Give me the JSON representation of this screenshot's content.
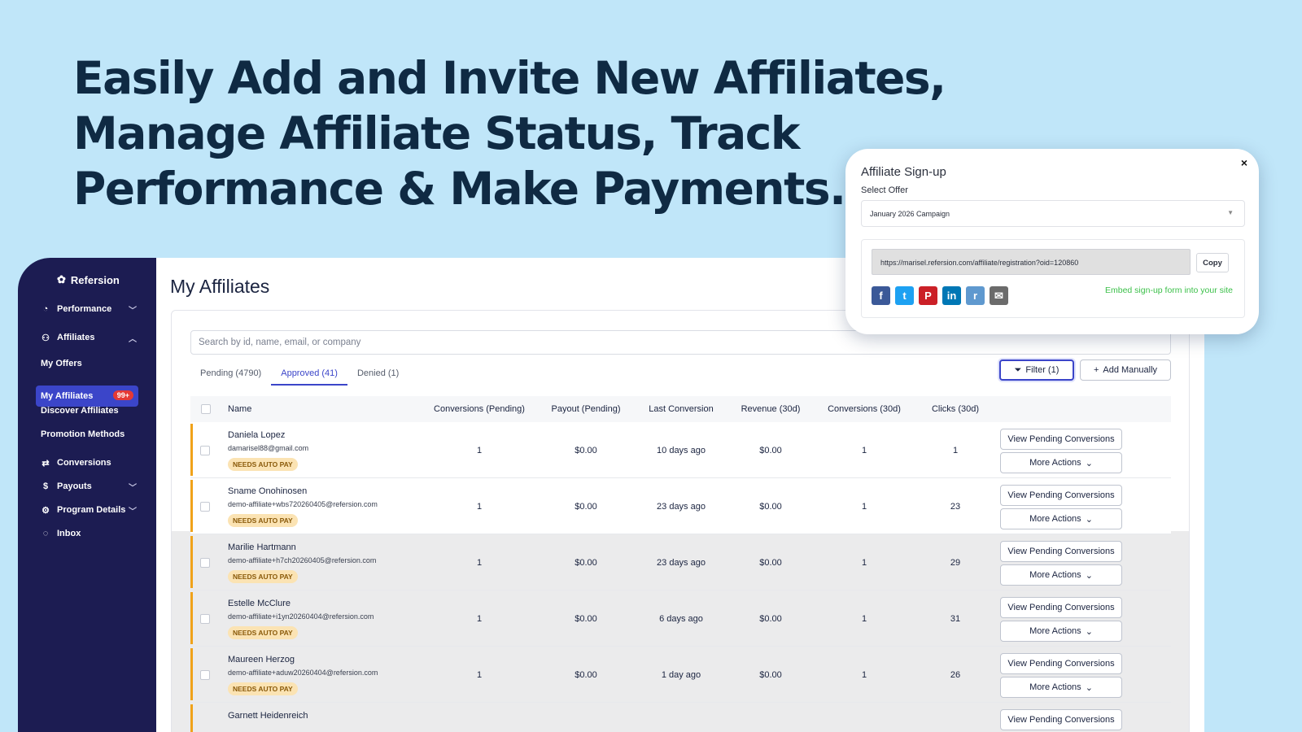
{
  "headline": [
    "Easily Add and Invite New Affiliates,",
    "Manage Affiliate Status, Track",
    "Performance & Make Payments."
  ],
  "sidebar": {
    "brand": "Refersion",
    "items": {
      "performance": "Performance",
      "affiliates": "Affiliates",
      "my_offers": "My Offers",
      "my_affiliates": "My Affiliates",
      "my_affiliates_badge": "99+",
      "discover": "Discover Affiliates",
      "promotion": "Promotion Methods",
      "conversions": "Conversions",
      "payouts": "Payouts",
      "program": "Program Details",
      "inbox": "Inbox"
    }
  },
  "main": {
    "title": "My Affiliates",
    "search_placeholder": "Search by id, name, email, or company",
    "tabs": [
      "Pending (4790)",
      "Approved (41)",
      "Denied (1)"
    ],
    "active_tab": 1,
    "filter_label": "Filter (1)",
    "add_label": "Add Manually",
    "columns": [
      "Name",
      "Conversions (Pending)",
      "Payout (Pending)",
      "Last Conversion",
      "Revenue (30d)",
      "Conversions (30d)",
      "Clicks (30d)"
    ],
    "status_label": "NEEDS AUTO PAY",
    "view_label": "View Pending Conversions",
    "more_label": "More Actions",
    "rows": [
      {
        "name": "Daniela Lopez",
        "email": "damarisel88@gmail.com",
        "conv_pending": "1",
        "payout_pending": "$0.00",
        "last_conv": "10 days ago",
        "revenue": "$0.00",
        "conv30": "1",
        "clicks": "1"
      },
      {
        "name": "Sname Onohinosen",
        "email": "demo-affiliate+wbs720260405@refersion.com",
        "conv_pending": "1",
        "payout_pending": "$0.00",
        "last_conv": "23 days ago",
        "revenue": "$0.00",
        "conv30": "1",
        "clicks": "23"
      },
      {
        "name": "Marilie Hartmann",
        "email": "demo-affiliate+h7ch20260405@refersion.com",
        "conv_pending": "1",
        "payout_pending": "$0.00",
        "last_conv": "23 days ago",
        "revenue": "$0.00",
        "conv30": "1",
        "clicks": "29"
      },
      {
        "name": "Estelle McClure",
        "email": "demo-affiliate+i1yn20260404@refersion.com",
        "conv_pending": "1",
        "payout_pending": "$0.00",
        "last_conv": "6 days ago",
        "revenue": "$0.00",
        "conv30": "1",
        "clicks": "31"
      },
      {
        "name": "Maureen Herzog",
        "email": "demo-affiliate+aduw20260404@refersion.com",
        "conv_pending": "1",
        "payout_pending": "$0.00",
        "last_conv": "1 day ago",
        "revenue": "$0.00",
        "conv30": "1",
        "clicks": "26"
      },
      {
        "name": "Garnett Heidenreich"
      }
    ]
  },
  "modal": {
    "title": "Affiliate Sign-up",
    "close": "×",
    "select_label": "Select Offer",
    "selected_offer": "January 2026 Campaign",
    "url": "https://marisel.refersion.com/affiliate/registration?oid=120860",
    "copy_label": "Copy",
    "embed_label": "Embed sign-up form into your site",
    "socials": [
      {
        "name": "facebook-icon",
        "glyph": "f",
        "color": "#3b5998"
      },
      {
        "name": "twitter-icon",
        "glyph": "t",
        "color": "#1da1f2"
      },
      {
        "name": "pinterest-icon",
        "glyph": "P",
        "color": "#cb2027"
      },
      {
        "name": "linkedin-icon",
        "glyph": "in",
        "color": "#0077b5"
      },
      {
        "name": "reddit-icon",
        "glyph": "r",
        "color": "#5f99cf"
      },
      {
        "name": "email-icon",
        "glyph": "✉",
        "color": "#6b6b6b"
      }
    ]
  },
  "colors": {
    "accent": "#3b45c9",
    "sidebar": "#1c1c52",
    "background": "#c0e6f9",
    "status": "#f0a21a"
  }
}
